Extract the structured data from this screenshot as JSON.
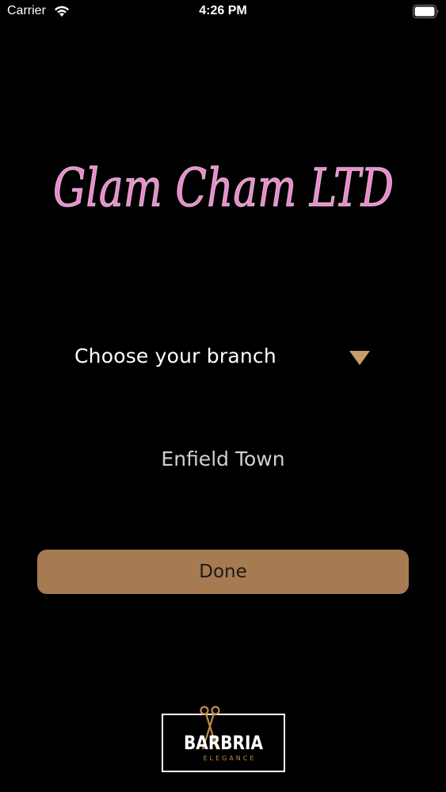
{
  "status_bar": {
    "carrier": "Carrier",
    "time": "4:26 PM"
  },
  "header": {
    "logo_text": "Glam Cham LTD",
    "logo_color": "#ee88cc"
  },
  "branch_picker": {
    "label": "Choose your branch",
    "selected": "Enfield Town",
    "chevron_color": "#c69c6d"
  },
  "actions": {
    "done_label": "Done",
    "done_color": "#a67b52"
  },
  "footer": {
    "brand_name": "BARBRIA",
    "brand_tagline": "ELEGANCE",
    "accent_color": "#c08a4a"
  }
}
